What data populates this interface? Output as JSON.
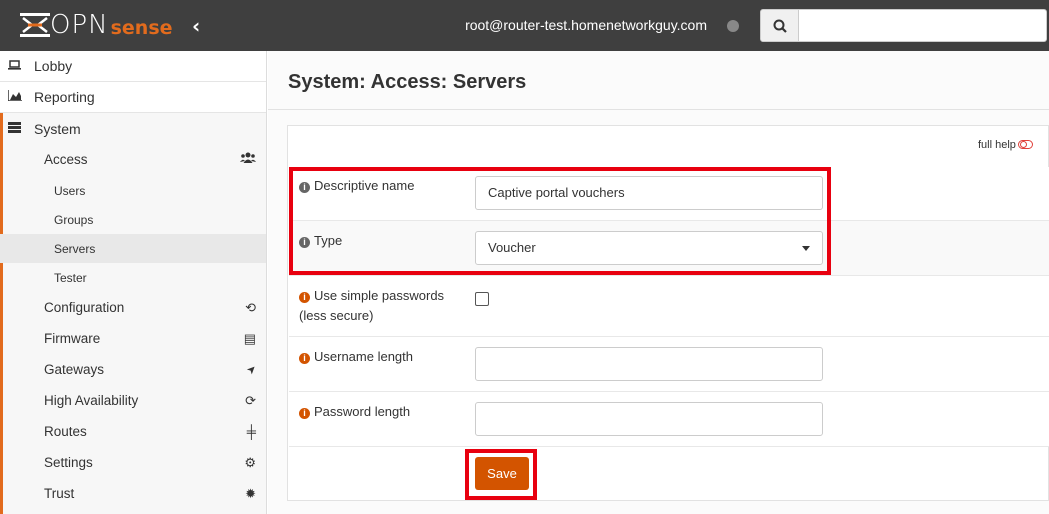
{
  "app": {
    "logo_main": "OPN",
    "logo_sense": "sense",
    "collapse_icon": "chevron-left-icon",
    "user": "root@router-test.homenetworkguy.com",
    "search_placeholder": ""
  },
  "sidebar": {
    "top_items": [
      {
        "label": "Lobby",
        "icon": "laptop-icon"
      },
      {
        "label": "Reporting",
        "icon": "area-chart-icon"
      },
      {
        "label": "System",
        "icon": "server-icon"
      }
    ],
    "system_items": [
      {
        "label": "Access",
        "icon": "users-icon",
        "glyph": "👥"
      },
      {
        "label": "Users"
      },
      {
        "label": "Groups"
      },
      {
        "label": "Servers",
        "active": true
      },
      {
        "label": "Tester"
      },
      {
        "label": "Configuration",
        "icon": "history-icon",
        "glyph": "⟲"
      },
      {
        "label": "Firmware",
        "icon": "building-icon",
        "glyph": "▤"
      },
      {
        "label": "Gateways",
        "icon": "location-arrow-icon",
        "glyph": "➤"
      },
      {
        "label": "High Availability",
        "icon": "refresh-icon",
        "glyph": "⟳"
      },
      {
        "label": "Routes",
        "icon": "map-signs-icon",
        "glyph": "╪"
      },
      {
        "label": "Settings",
        "icon": "cogs-icon",
        "glyph": "⚙"
      },
      {
        "label": "Trust",
        "icon": "certificate-icon",
        "glyph": "✹"
      }
    ]
  },
  "page": {
    "title": "System: Access: Servers",
    "full_help": "full help"
  },
  "form": {
    "descriptive_name": {
      "label": "Descriptive name",
      "value": "Captive portal vouchers"
    },
    "type": {
      "label": "Type",
      "value": "Voucher"
    },
    "simple_passwords": {
      "label_line1": "Use simple passwords",
      "label_line2": "(less secure)",
      "checked": false
    },
    "username_length": {
      "label": "Username length",
      "value": ""
    },
    "password_length": {
      "label": "Password length",
      "value": ""
    },
    "save_label": "Save"
  },
  "colors": {
    "accent": "#d35400",
    "highlight": "#e8000f",
    "topbar": "#3f3f3f"
  }
}
